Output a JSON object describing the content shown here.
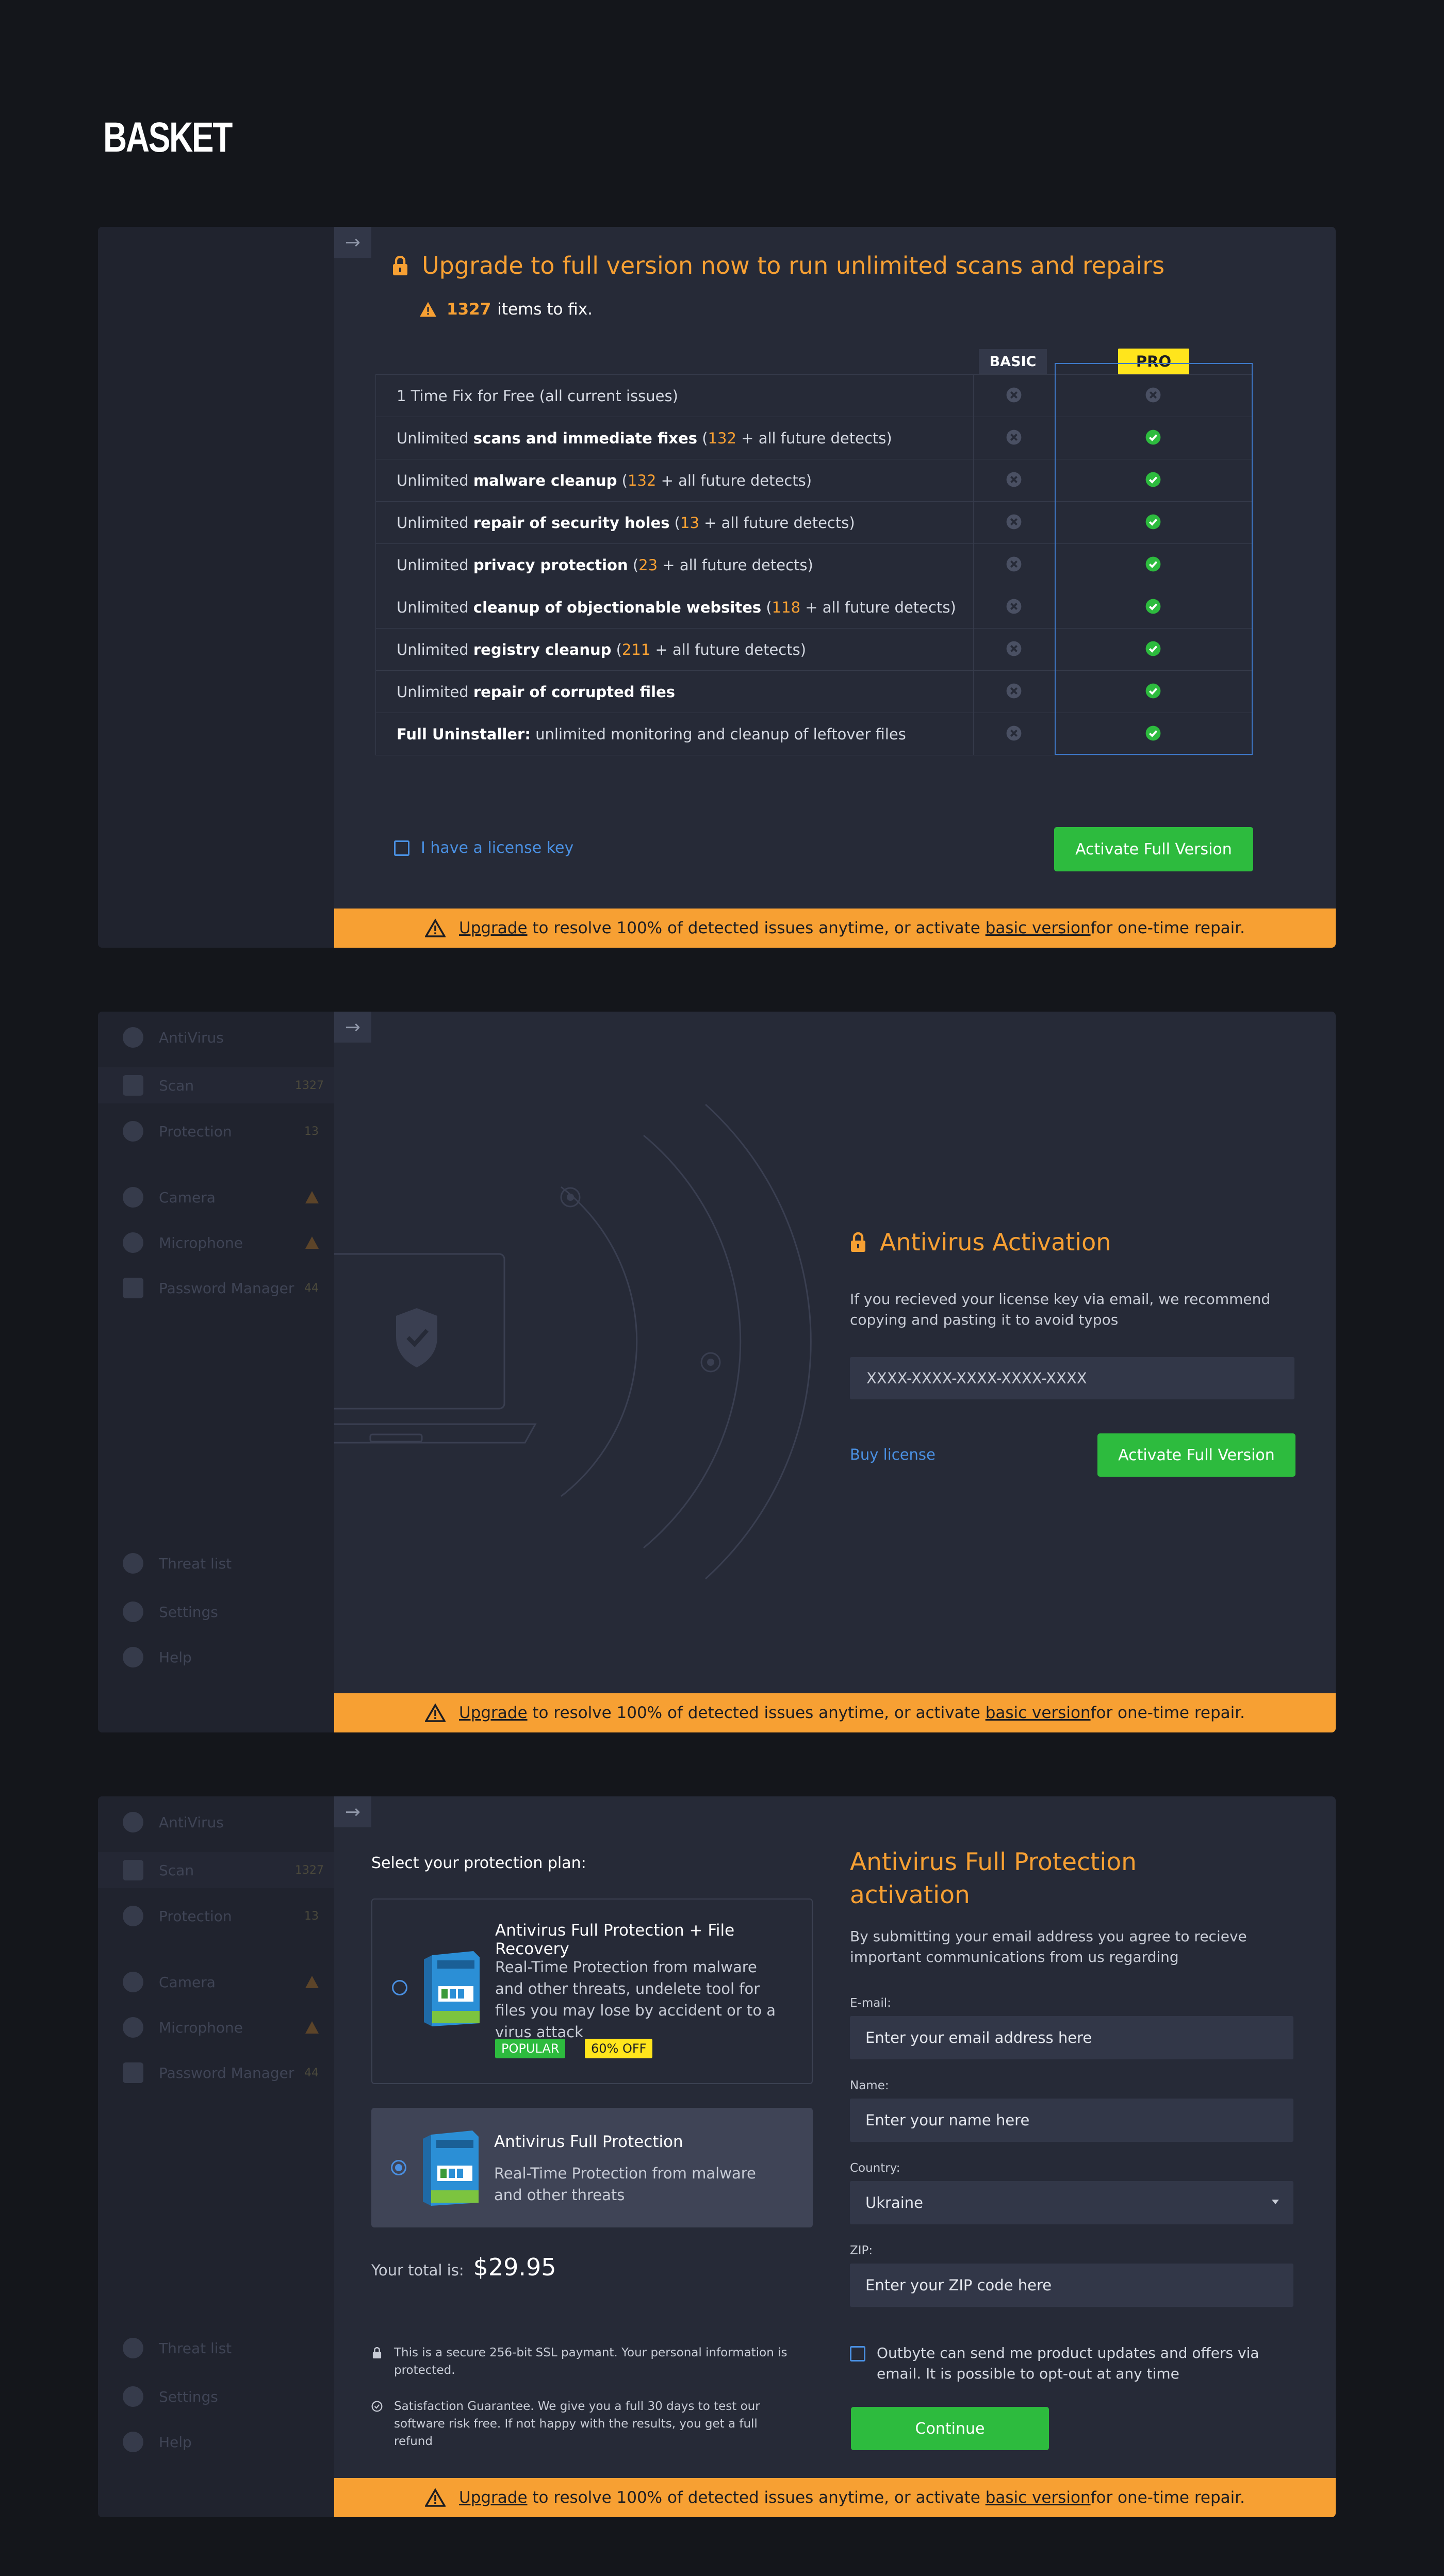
{
  "page": {
    "title": "BASKET"
  },
  "banner": {
    "upgrade_link": "Upgrade",
    "middle": " to resolve 100% of detected issues anytime, or activate ",
    "basic_link": "basic version",
    "end": " for one-time repair."
  },
  "collapse_icon": "arrow-right-icon",
  "colors": {
    "accent": "#f7a033",
    "success": "#2dbb3e",
    "link": "#4a90e2",
    "pro": "#ffe51c",
    "background": "#14161b",
    "panel": "#262a37"
  },
  "upgrade": {
    "title": "Upgrade to full version now to run unlimited scans and repairs",
    "items_count": "1327",
    "items_label": "items to fix.",
    "col_basic": "BASIC",
    "col_pro": "PRO",
    "rows": [
      {
        "plain1": "1 Time Fix for Free (all current issues)",
        "bold": "",
        "open": "",
        "num": "",
        "tail": "",
        "basic": "x",
        "pro": "x"
      },
      {
        "plain1": "Unlimited ",
        "bold": "scans and immediate fixes",
        "open": " (",
        "num": "132",
        "tail": " + all future detects)",
        "basic": "x",
        "pro": "check"
      },
      {
        "plain1": "Unlimited ",
        "bold": "malware cleanup",
        "open": " (",
        "num": "132",
        "tail": " + all future detects)",
        "basic": "x",
        "pro": "check"
      },
      {
        "plain1": "Unlimited ",
        "bold": "repair of security holes",
        "open": " (",
        "num": "13",
        "tail": " + all future detects)",
        "basic": "x",
        "pro": "check"
      },
      {
        "plain1": "Unlimited ",
        "bold": "privacy protection",
        "open": " (",
        "num": "23",
        "tail": " + all future detects)",
        "basic": "x",
        "pro": "check"
      },
      {
        "plain1": "Unlimited ",
        "bold": "cleanup of objectionable websites",
        "open": " (",
        "num": "118",
        "tail": " + all future detects)",
        "basic": "x",
        "pro": "check"
      },
      {
        "plain1": "Unlimited ",
        "bold": "registry cleanup",
        "open": " (",
        "num": "211",
        "tail": " + all future detects)",
        "basic": "x",
        "pro": "check"
      },
      {
        "plain1": "Unlimited ",
        "bold": "repair of corrupted files",
        "open": "",
        "num": "",
        "tail": "",
        "basic": "x",
        "pro": "check"
      },
      {
        "plain1": "",
        "bold": "Full Uninstaller:",
        "open": "",
        "num": "",
        "tail": " unlimited monitoring and cleanup of leftover files",
        "basic": "x",
        "pro": "check"
      }
    ],
    "license_checkbox": "I have a license key",
    "activate_button": "Activate Full Version"
  },
  "sidebar": {
    "app_name": "AntiVirus",
    "items": [
      {
        "label": "Scan",
        "badge": "1327",
        "icon": "scan-icon"
      },
      {
        "label": "Protection",
        "badge": "13",
        "icon": "shield-icon"
      },
      {
        "label": "Camera",
        "badge": "",
        "icon": "camera-icon"
      },
      {
        "label": "Microphone",
        "badge": "",
        "icon": "microphone-icon"
      },
      {
        "label": "Password Manager",
        "badge": "44",
        "icon": "password-icon"
      }
    ],
    "bottom": [
      {
        "label": "Threat list",
        "icon": "threat-list-icon"
      },
      {
        "label": "Settings",
        "icon": "gear-icon"
      },
      {
        "label": "Help",
        "icon": "help-icon"
      }
    ]
  },
  "activation": {
    "title": "Antivirus Activation",
    "description": "If you recieved your license key via email, we recommend copying and pasting it to avoid typos",
    "key_placeholder": "XXXX-XXXX-XXXX-XXXX-XXXX",
    "buy_link": "Buy license",
    "activate_button": "Activate Full Version"
  },
  "purchase": {
    "plan_heading": "Select your protection plan:",
    "plans": [
      {
        "name": "Antivirus Full Protection + File Recovery",
        "description": "Real-Time Protection from malware and other threats, undelete tool for files you may lose by accident or to a virus attack",
        "badge_popular": "POPULAR",
        "badge_discount": "60% OFF",
        "selected": false
      },
      {
        "name": "Antivirus Full Protection",
        "description": "Real-Time Protection from malware and other threats",
        "selected": true
      }
    ],
    "total_label": "Your total is:",
    "total_value": "$29.95",
    "ssl_note": "This is a secure 256-bit SSL paymant. Your personal information is protected.",
    "guarantee_note": "Satisfaction Guarantee. We give you a full 30 days to test our software risk free. If not happy with the results, you get a full refund",
    "form_title": "Antivirus Full Protection activation",
    "form_description": "By submitting your email address you agree to recieve important communications from us regarding",
    "email_label": "E-mail:",
    "email_placeholder": "Enter your email address here",
    "name_label": "Name:",
    "name_placeholder": "Enter your name here",
    "country_label": "Country:",
    "country_value": "Ukraine",
    "zip_label": "ZIP:",
    "zip_placeholder": "Enter your ZIP code here",
    "optin_text": "Outbyte can send me product updates and offers via email. It is possible to opt-out at any time",
    "continue_button": "Continue"
  }
}
